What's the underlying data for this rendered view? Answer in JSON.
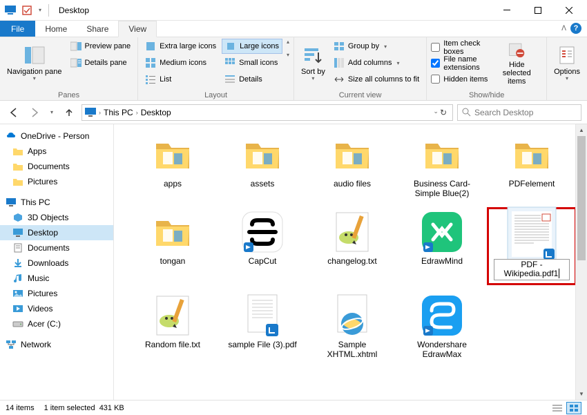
{
  "window": {
    "title": "Desktop"
  },
  "tabs": {
    "file": "File",
    "items": [
      "Home",
      "Share",
      "View"
    ],
    "active_index": 2
  },
  "ribbon": {
    "panes": {
      "label": "Panes",
      "nav": "Navigation pane",
      "preview": "Preview pane",
      "details": "Details pane",
      "nav_drop": "▾"
    },
    "layout": {
      "label": "Layout",
      "extra_large": "Extra large icons",
      "large": "Large icons",
      "medium": "Medium icons",
      "small": "Small icons",
      "list": "List",
      "details": "Details"
    },
    "current_view": {
      "label": "Current view",
      "sort": "Sort by",
      "group": "Group by",
      "add_cols": "Add columns",
      "size_cols": "Size all columns to fit",
      "drop": "▾"
    },
    "show_hide": {
      "label": "Show/hide",
      "item_check": "Item check boxes",
      "file_ext": "File name extensions",
      "hidden": "Hidden items",
      "hide_selected": "Hide selected items"
    },
    "options": "Options"
  },
  "breadcrumb": {
    "root_icon": "monitor",
    "parts": [
      "This PC",
      "Desktop"
    ]
  },
  "search": {
    "placeholder": "Search Desktop"
  },
  "tree": {
    "onedrive": "OneDrive - Person",
    "onedrive_children": [
      "Apps",
      "Documents",
      "Pictures"
    ],
    "this_pc": "This PC",
    "this_pc_children": [
      "3D Objects",
      "Desktop",
      "Documents",
      "Downloads",
      "Music",
      "Pictures",
      "Videos",
      "Acer (C:)"
    ],
    "selected": "Desktop",
    "network": "Network"
  },
  "files": [
    {
      "name": "apps",
      "type": "folder"
    },
    {
      "name": "assets",
      "type": "folder"
    },
    {
      "name": "audio files",
      "type": "folder"
    },
    {
      "name": "Business Card-Simple Blue(2)",
      "type": "folder"
    },
    {
      "name": "PDFelement",
      "type": "folder"
    },
    {
      "name": "tongan",
      "type": "folder"
    },
    {
      "name": "CapCut",
      "type": "app"
    },
    {
      "name": "changelog.txt",
      "type": "txt"
    },
    {
      "name": "EdrawMind",
      "type": "app-green"
    },
    {
      "name": "PDF - Wikipedia.pdf1",
      "type": "pdf",
      "editing": true
    },
    {
      "name": "Random file.txt",
      "type": "txt"
    },
    {
      "name": "sample File (3).pdf",
      "type": "pdf-plain"
    },
    {
      "name": "Sample XHTML.xhtml",
      "type": "ie"
    },
    {
      "name": "Wondershare EdrawMax",
      "type": "app-blue"
    }
  ],
  "status": {
    "count": "14 items",
    "selected": "1 item selected",
    "size": "431 KB"
  },
  "checkbox_states": {
    "item_check": false,
    "file_ext": true,
    "hidden": false
  }
}
